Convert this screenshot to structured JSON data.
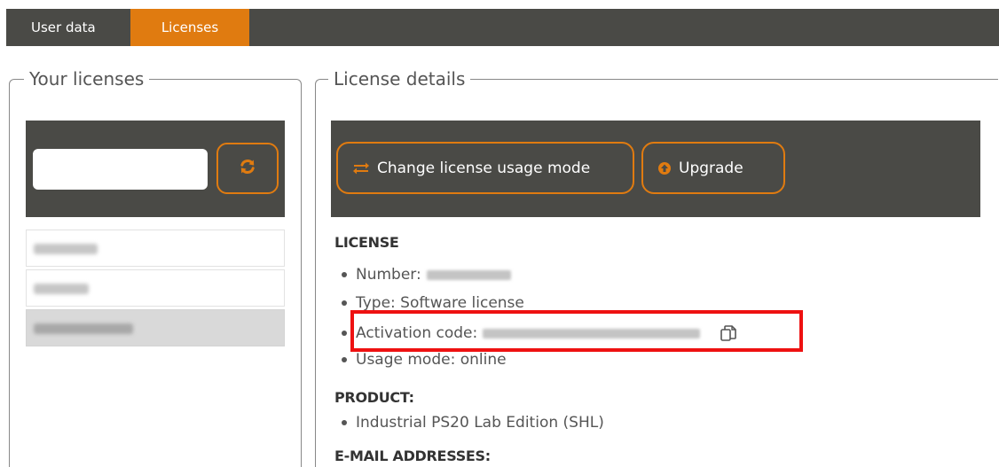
{
  "tabs": [
    {
      "label": "User data",
      "active": false
    },
    {
      "label": "Licenses",
      "active": true
    }
  ],
  "left_panel": {
    "legend": "Your licenses",
    "search": {
      "value": "",
      "placeholder": ""
    },
    "refresh_icon": "refresh-icon",
    "licenses": [
      {
        "label_blurred": true,
        "selected": false
      },
      {
        "label_blurred": true,
        "selected": false
      },
      {
        "label_blurred": true,
        "selected": true
      }
    ]
  },
  "right_panel": {
    "legend": "License details",
    "buttons": {
      "change_mode": "Change license usage mode",
      "upgrade": "Upgrade"
    },
    "license": {
      "heading": "LICENSE",
      "number_label": "Number:",
      "type_text": "Type: Software license",
      "activation_label": "Activation code:",
      "usage_text": "Usage mode: online"
    },
    "product": {
      "heading": "PRODUCT:",
      "item": "Industrial PS20 Lab Edition (SHL)"
    },
    "emails": {
      "heading": "E-MAIL ADDRESSES:"
    }
  },
  "colors": {
    "accent": "#e07b10",
    "toolbar": "#4a4a46",
    "highlight": "#ee1111"
  }
}
